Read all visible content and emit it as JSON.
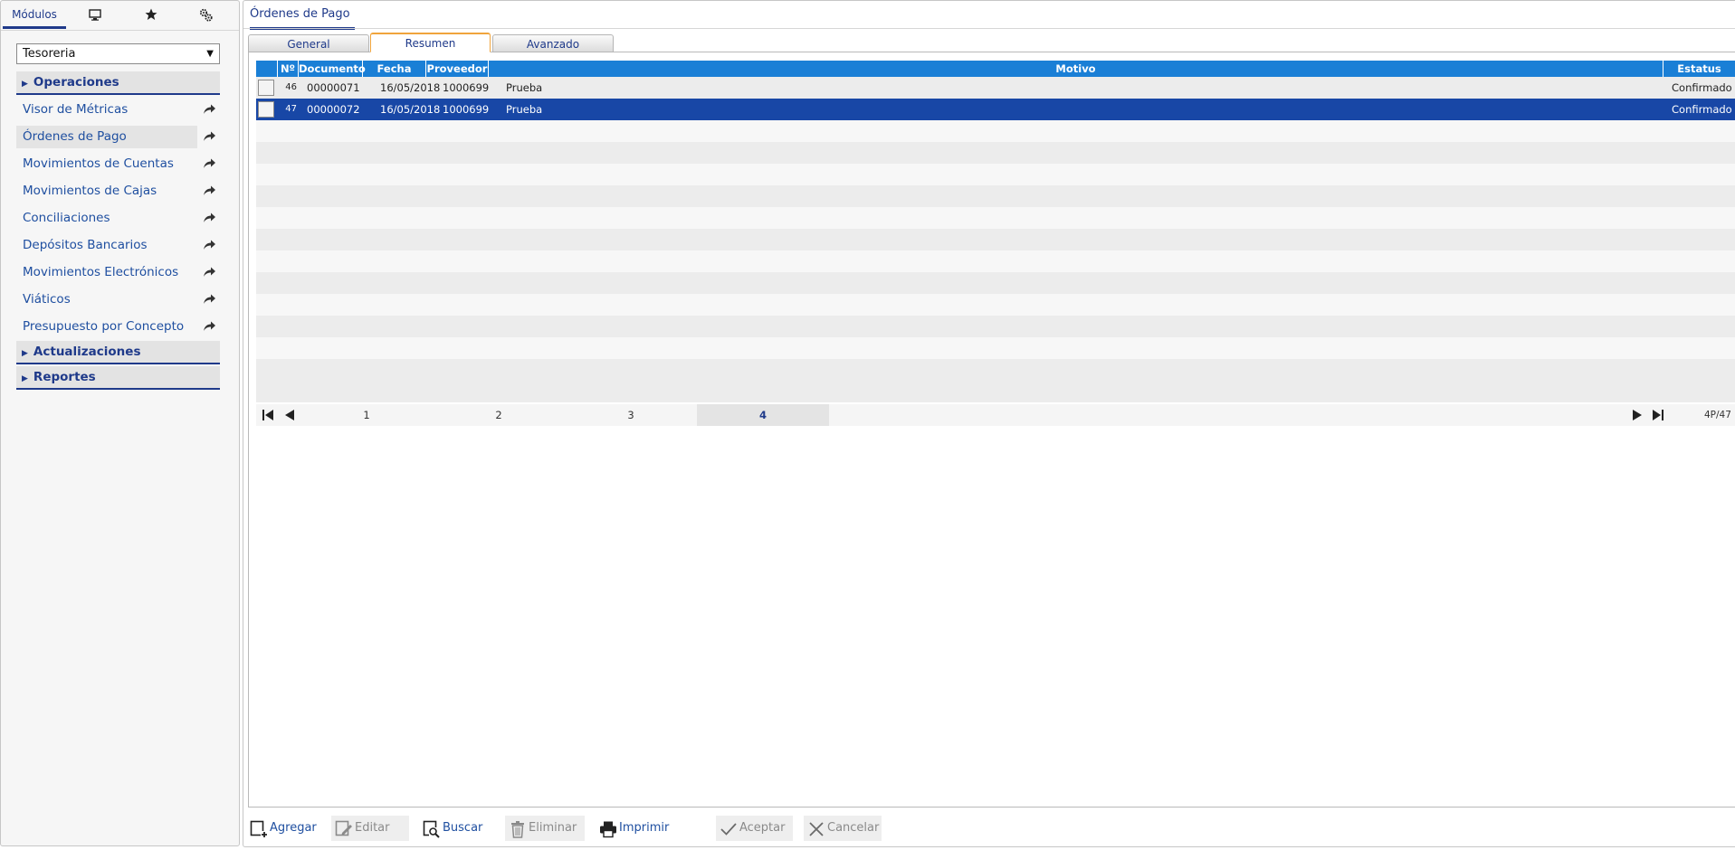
{
  "sidebar": {
    "tabs": [
      {
        "label": "Módulos",
        "icon": null
      },
      {
        "label": "",
        "icon": "monitor-icon"
      },
      {
        "label": "",
        "icon": "star-icon"
      },
      {
        "label": "",
        "icon": "gears-icon"
      }
    ],
    "module_select": "Tesoreria",
    "groups": {
      "operaciones": "Operaciones",
      "actualizaciones": "Actualizaciones",
      "reportes": "Reportes"
    },
    "items": [
      "Visor de Métricas",
      "Órdenes de Pago",
      "Movimientos de Cuentas",
      "Movimientos de Cajas",
      "Conciliaciones",
      "Depósitos Bancarios",
      "Movimientos Electrónicos",
      "Viáticos",
      "Presupuesto por Concepto"
    ],
    "selected_item": "Órdenes de Pago"
  },
  "main": {
    "title": "Órdenes de Pago",
    "tabs": [
      "General",
      "Resumen",
      "Avanzado"
    ],
    "active_tab": "Resumen"
  },
  "grid": {
    "columns": [
      "Nº",
      "Documento",
      "Fecha",
      "Proveedor",
      "Motivo",
      "Estatus"
    ],
    "rows": [
      {
        "n": "46",
        "documento": "00000071",
        "fecha": "16/05/2018",
        "proveedor": "1000699",
        "motivo": "Prueba",
        "estatus": "Confirmado",
        "selected": false
      },
      {
        "n": "47",
        "documento": "00000072",
        "fecha": "16/05/2018",
        "proveedor": "1000699",
        "motivo": "Prueba",
        "estatus": "Confirmado",
        "selected": true
      }
    ],
    "pager": {
      "pages": [
        "1",
        "2",
        "3",
        "4"
      ],
      "current": "4",
      "summary": "4P/47"
    }
  },
  "toolbar": {
    "agregar": "Agregar",
    "editar": "Editar",
    "buscar": "Buscar",
    "eliminar": "Eliminar",
    "imprimir": "Imprimir",
    "aceptar": "Aceptar",
    "cancelar": "Cancelar"
  },
  "colors": {
    "brand": "#1f3a8a",
    "grid_header": "#1a7fd6",
    "selected_row": "#1847a6",
    "active_tab_accent": "#f0a43c"
  }
}
